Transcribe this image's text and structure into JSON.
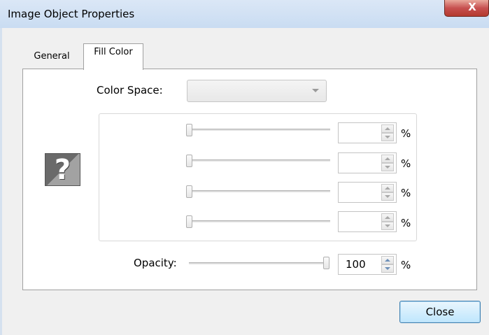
{
  "window": {
    "title": "Image Object Properties",
    "close_glyph": "X"
  },
  "tabs": [
    {
      "label": "General",
      "active": false
    },
    {
      "label": "Fill Color",
      "active": true
    }
  ],
  "fill_color": {
    "color_space_label": "Color Space:",
    "color_space_value": "",
    "preview_icon": "question-mark-icon",
    "preview_glyph": "?",
    "channels": [
      {
        "value": "",
        "unit": "%",
        "slider_level": 0
      },
      {
        "value": "",
        "unit": "%",
        "slider_level": 0
      },
      {
        "value": "",
        "unit": "%",
        "slider_level": 0
      },
      {
        "value": "",
        "unit": "%",
        "slider_level": 0
      }
    ],
    "opacity_label": "Opacity:",
    "opacity_value": "100",
    "opacity_unit": "%",
    "opacity_level": 1.0
  },
  "footer": {
    "close_label": "Close"
  },
  "colors": {
    "accent_button_border": "#3c7fb1",
    "close_x": "#c75050",
    "titlebar": "#c9dcf2"
  }
}
